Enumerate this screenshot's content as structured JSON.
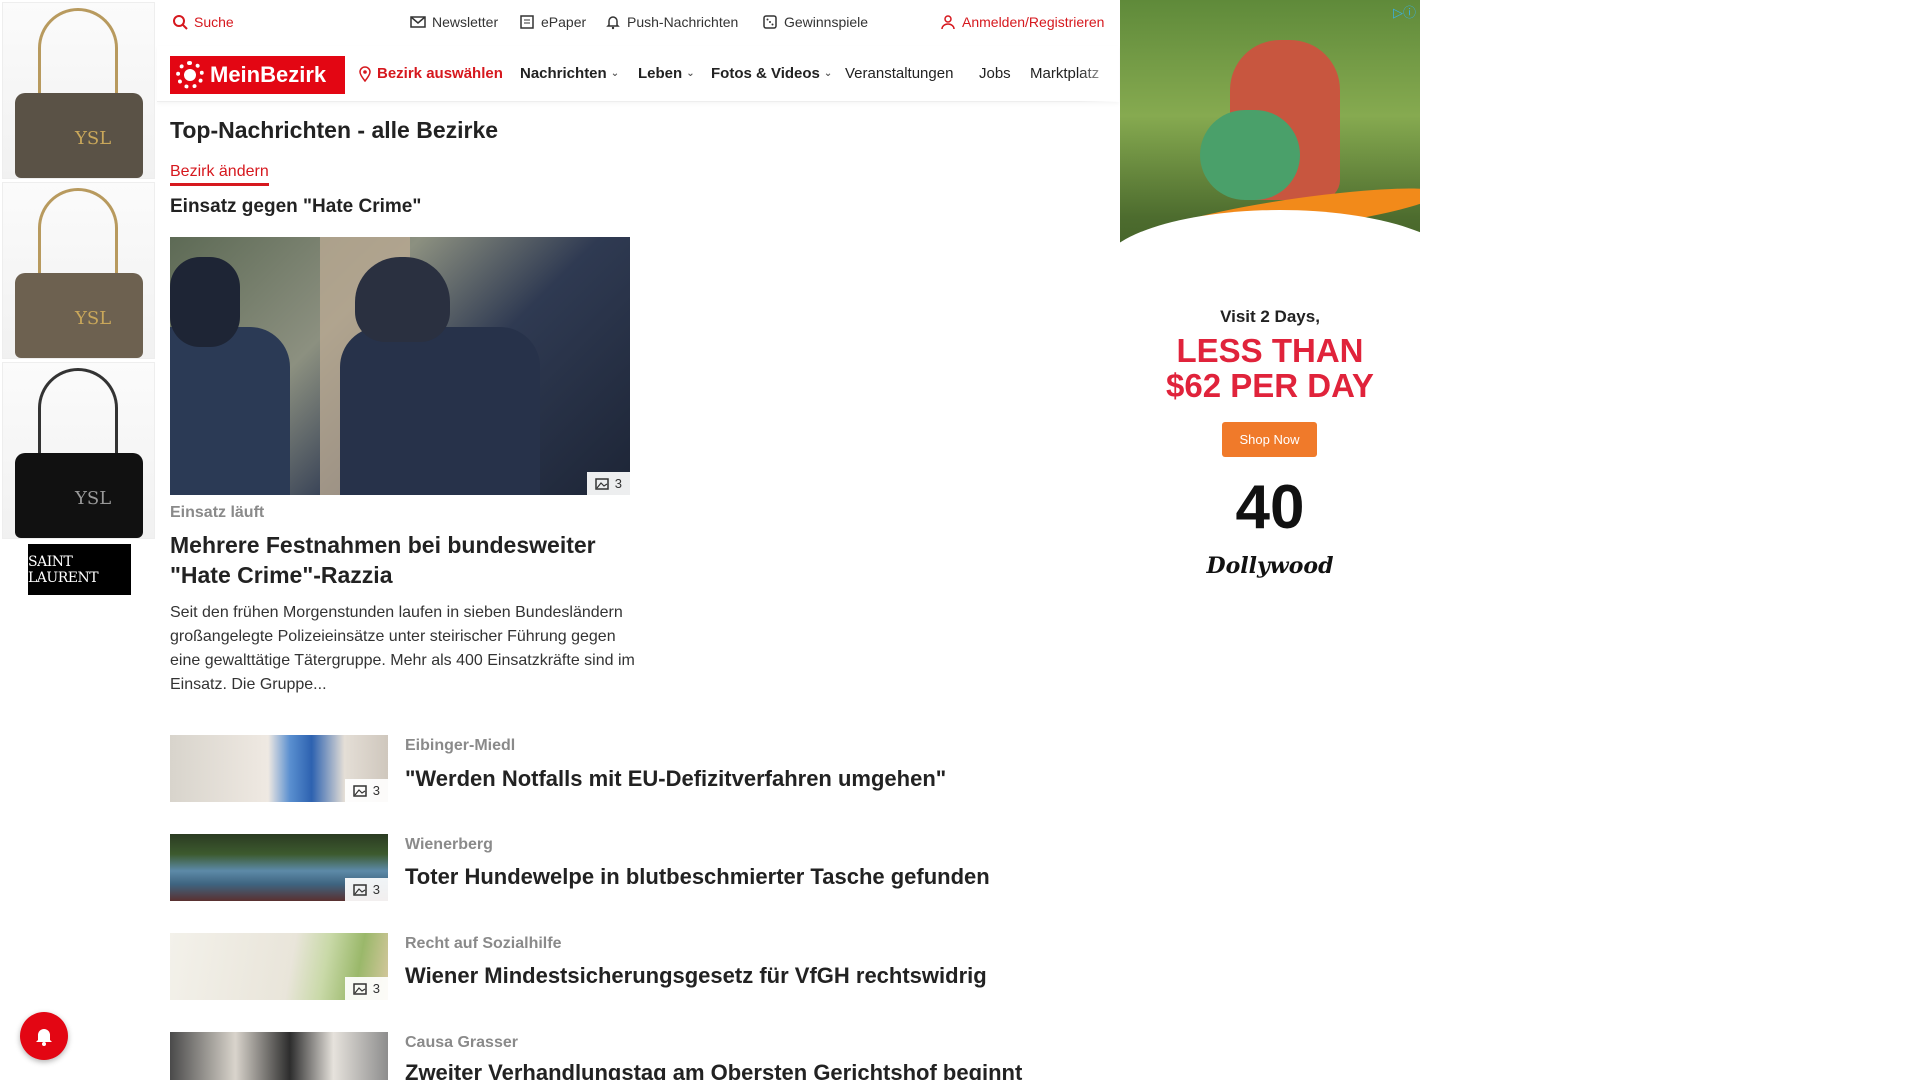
{
  "topbar": {
    "search": "Suche",
    "newsletter": "Newsletter",
    "epaper": "ePaper",
    "push": "Push-Nachrichten",
    "gewinnspiele": "Gewinnspiele",
    "login": "Anmelden/Registrieren"
  },
  "nav": {
    "brand": "MeinBezirk",
    "bezirk": "Bezirk auswählen",
    "items": [
      "Nachrichten",
      "Leben",
      "Fotos & Videos",
      "Veranstaltungen",
      "Jobs",
      "Marktplatz"
    ]
  },
  "page": {
    "title": "Top-Nachrichten - alle Bezirke",
    "change_link": "Bezirk ändern",
    "topic": "Einsatz gegen \"Hate Crime\""
  },
  "hero": {
    "image_count": "3",
    "kicker": "Einsatz läuft",
    "title": "Mehrere Festnahmen bei bundesweiter \"Hate Crime\"-Razzia",
    "text": "Seit den frühen Morgenstunden laufen in sieben Bundesländern großangelegte Polizeieinsätze unter steirischer Führung gegen eine gewalttätige Tätergruppe. Mehr als 400 Einsatzkräfte sind im Einsatz. Die Gruppe..."
  },
  "articles": [
    {
      "kicker": "Eibinger-Miedl",
      "title": "\"Werden Notfalls mit EU-Defizitverfahren umgehen\"",
      "count": "3"
    },
    {
      "kicker": "Wienerberg",
      "title": "Toter Hundewelpe in blutbeschmierter Tasche gefunden",
      "count": "3"
    },
    {
      "kicker": "Recht auf Sozialhilfe",
      "title": "Wiener Mindestsicherungsgesetz für VfGH rechtswidrig",
      "count": "3"
    },
    {
      "kicker": "Causa Grasser",
      "title": "Zweiter Verhandlungstag am Obersten Gerichtshof beginnt",
      "count": ""
    }
  ],
  "left_ad": {
    "brand": "SAINT LAURENT",
    "bag_logo": "YSL"
  },
  "right_ad": {
    "visit": "Visit 2 Days,",
    "offer_line1": "LESS THAN",
    "offer_line2": "$62 PER DAY",
    "cta": "Shop Now",
    "anniversary": "40",
    "brand": "Dollywood"
  },
  "colors": {
    "brand_red": "#e30613",
    "ad_red": "#e0233b",
    "ad_orange": "#f07a2a"
  }
}
